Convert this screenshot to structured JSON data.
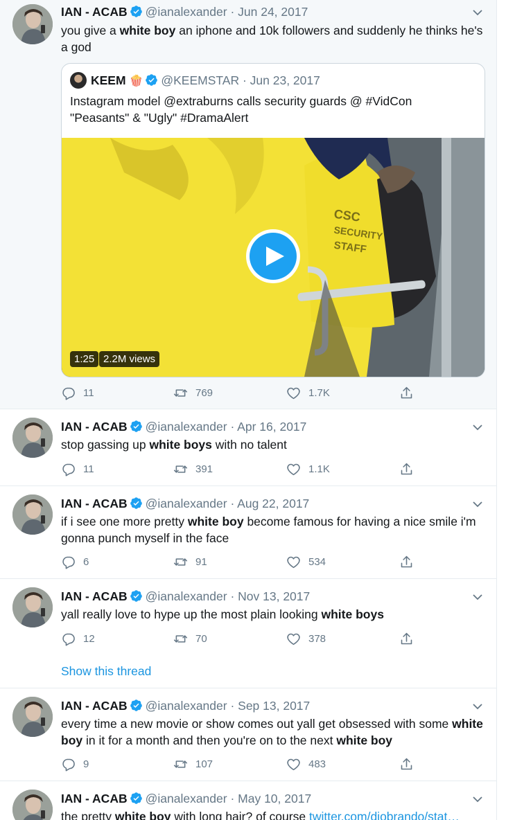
{
  "author": {
    "name": "IAN - ACAB",
    "handle": "@ianalexander"
  },
  "actions_icons": [
    "reply-icon",
    "retweet-icon",
    "like-icon",
    "share-icon"
  ],
  "colors": {
    "link": "#1b95e0",
    "verified": "#1da1f2",
    "muted": "#657786"
  },
  "tweets": [
    {
      "date": "Jun 24, 2017",
      "text": [
        {
          "t": "you give a "
        },
        {
          "t": "white boy",
          "b": true
        },
        {
          "t": " an iphone and 10k followers and suddenly he thinks he's a god"
        }
      ],
      "quote": {
        "name": "KEEM",
        "emoji": "🍿",
        "handle": "@KEEMSTAR",
        "date": "Jun 23, 2017",
        "text": "Instagram model @extraburns calls security guards @ #VidCon \"Peasants\" & \"Ugly\" #DramaAlert",
        "duration": "1:25",
        "views": "2.2M views",
        "shirt_text": [
          "CSC",
          "SECURITY",
          "STAFF"
        ]
      },
      "replies": "11",
      "retweets": "769",
      "likes": "1.7K"
    },
    {
      "date": "Apr 16, 2017",
      "text": [
        {
          "t": "stop gassing up "
        },
        {
          "t": "white boys",
          "b": true
        },
        {
          "t": " with no talent"
        }
      ],
      "replies": "11",
      "retweets": "391",
      "likes": "1.1K"
    },
    {
      "date": "Aug 22, 2017",
      "text": [
        {
          "t": "if i see one more pretty "
        },
        {
          "t": "white boy",
          "b": true
        },
        {
          "t": " become famous for having a nice smile i'm gonna punch myself in the face"
        }
      ],
      "replies": "6",
      "retweets": "91",
      "likes": "534"
    },
    {
      "date": "Nov 13, 2017",
      "text": [
        {
          "t": "yall really love to hype up the most plain looking "
        },
        {
          "t": "white boys",
          "b": true
        }
      ],
      "replies": "12",
      "retweets": "70",
      "likes": "378",
      "thread_link": "Show this thread"
    },
    {
      "date": "Sep 13, 2017",
      "text": [
        {
          "t": "every time a new movie or show comes out yall get obsessed with some "
        },
        {
          "t": "white boy",
          "b": true
        },
        {
          "t": " in it for a month and then you're on to the next "
        },
        {
          "t": "white boy",
          "b": true
        }
      ],
      "replies": "9",
      "retweets": "107",
      "likes": "483"
    },
    {
      "date": "May 10, 2017",
      "text": [
        {
          "t": "the pretty "
        },
        {
          "t": "white boy",
          "b": true
        },
        {
          "t": " with long hair? of course "
        },
        {
          "t": "twitter.com/diobrando/stat…",
          "link": true
        }
      ]
    }
  ]
}
